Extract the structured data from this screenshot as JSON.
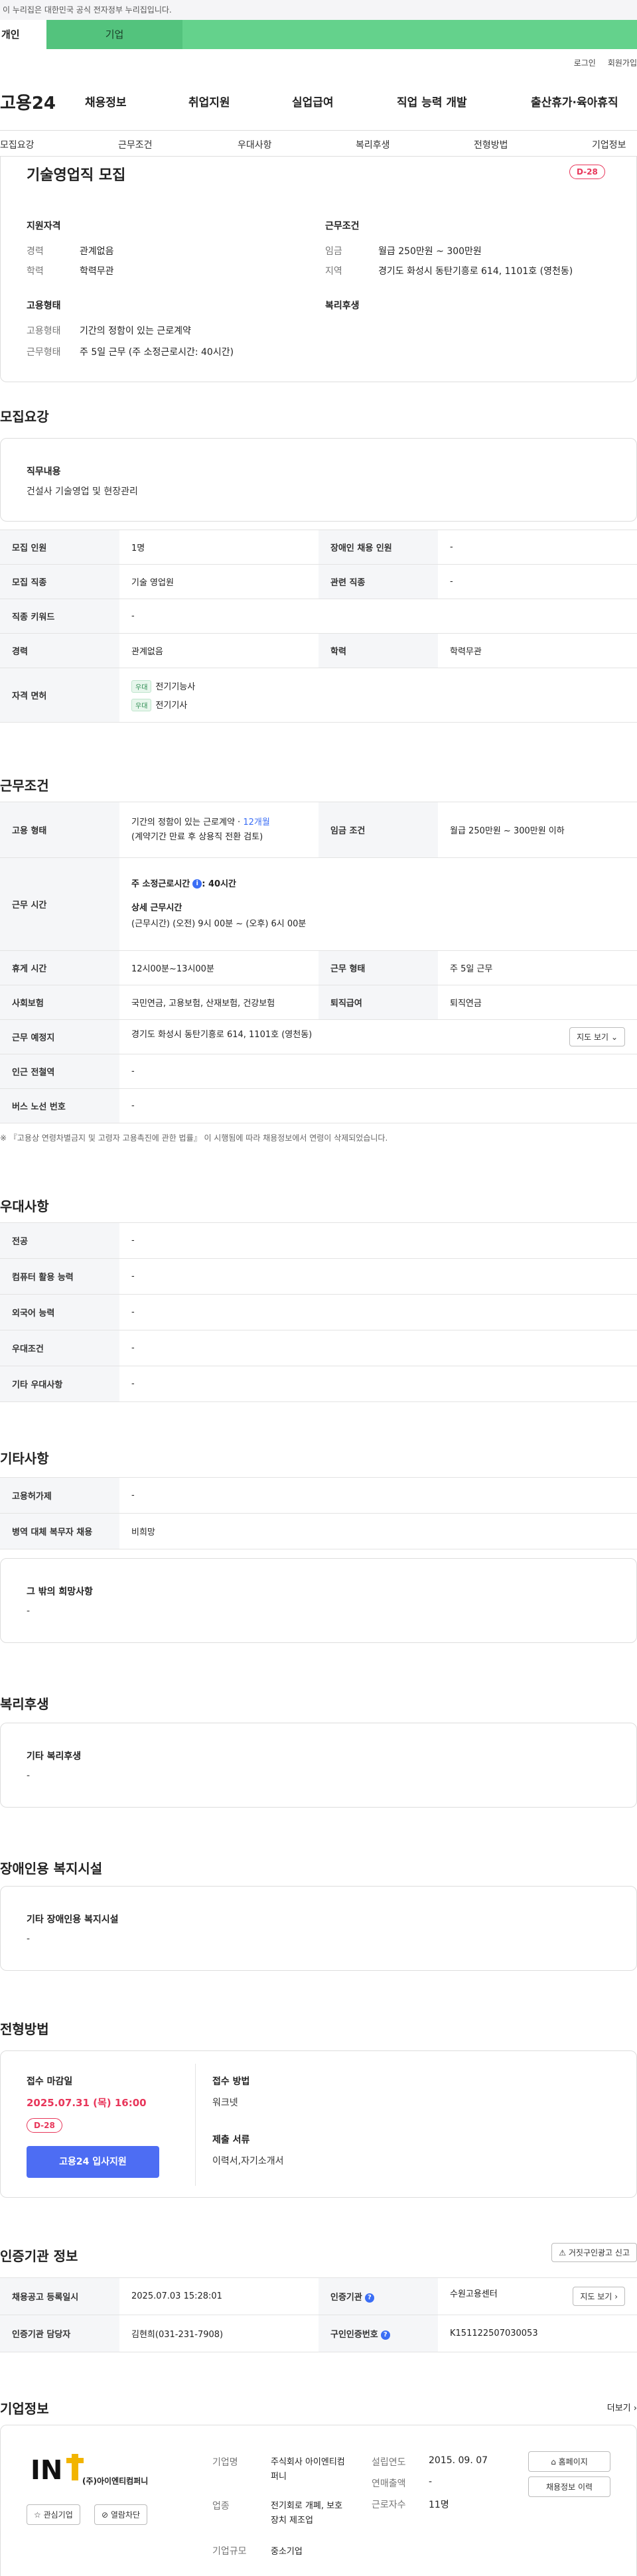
{
  "gov_banner": "이 누리집은 대한민국 공식 전자정부 누리집입니다.",
  "top_tabs": [
    "개인",
    "기업"
  ],
  "util_links": [
    "로그인",
    "회원가입"
  ],
  "logo": "고용24",
  "gnb": [
    "채용정보",
    "취업지원",
    "실업급여",
    "직업 능력 개발",
    "출산휴가·육아휴직"
  ],
  "subnav": [
    "모집요강",
    "근무조건",
    "우대사항",
    "복리후생",
    "전형방법",
    "기업정보"
  ],
  "job": {
    "title": "기술영업직 모집",
    "dday": "D-28",
    "summary": {
      "qual_h": "지원자격",
      "career_l": "경력",
      "career_v": "관계없음",
      "edu_l": "학력",
      "edu_v": "학력무관",
      "cond_h": "근무조건",
      "pay_l": "임금",
      "pay_v": "월급 250만원 ~ 300만원",
      "loc_l": "지역",
      "loc_v": "경기도 화성시 동탄기흥로 614, 1101호 (영천동)",
      "emp_h": "고용형태",
      "emp_type_l": "고용형태",
      "emp_type_v": "기간의 정함이 있는 근로계약",
      "work_form_l": "근무형태",
      "work_form_v": "주 5일 근무 (주 소정근로시간: 40시간)",
      "welfare_h": "복리후생"
    }
  },
  "recruit": {
    "heading": "모집요강",
    "duty_h": "직무내용",
    "duty_v": "건설사 기술영업 및 현장관리",
    "rows": {
      "headcount_l": "모집 인원",
      "headcount_v": "1명",
      "disabled_l": "장애인 채용 인원",
      "disabled_v": "-",
      "job_l": "모집 직종",
      "job_v": "기술 영업원",
      "related_l": "관련 직종",
      "related_v": "-",
      "kw_l": "직종 키워드",
      "kw_v": "-",
      "career_l": "경력",
      "career_v": "관계없음",
      "edu_l": "학력",
      "edu_v": "학력무관",
      "license_l": "자격 면허",
      "license_tag": "우대",
      "license_1": "전기기능사",
      "license_2": "전기기사"
    }
  },
  "work": {
    "heading": "근무조건",
    "emp_l": "고용 형태",
    "emp_v1": "기간의 정함이 있는 근로계약 · ",
    "emp_months": "12개월",
    "emp_v2": "(계약기간 만료 후 상용직 전환 검토)",
    "pay_l": "임금 조건",
    "pay_v": "월급 250만원 ~ 300만원 이하",
    "hours_l": "근무 시간",
    "hours_main": "주 소정근로시간",
    "hours_main_v": ": 40시간",
    "hours_detail_h": "상세 근무시간",
    "hours_detail_v": "(근무시간) (오전) 9시 00분 ~ (오후) 6시 00분",
    "rest_l": "휴게 시간",
    "rest_v": "12시00분~13시00분",
    "form_l": "근무 형태",
    "form_v": "주 5일 근무",
    "ins_l": "사회보험",
    "ins_v": "국민연금, 고용보험, 산재보험, 건강보험",
    "retire_l": "퇴직급여",
    "retire_v": "퇴직연금",
    "place_l": "근무 예정지",
    "place_v": "경기도 화성시 동탄기흥로 614, 1101호 (영천동)",
    "map_btn": "지도 보기",
    "station_l": "인근 전철역",
    "station_v": "-",
    "bus_l": "버스 노선 번호",
    "bus_v": "-",
    "note": "※ 『고용상 연령차별금지 및 고령자 고용촉진에 관한 법률』 이 시행됨에 따라 채용정보에서 연령이 삭제되었습니다."
  },
  "pref": {
    "heading": "우대사항",
    "rows": [
      {
        "l": "전공",
        "v": "-"
      },
      {
        "l": "컴퓨터 활용 능력",
        "v": "-"
      },
      {
        "l": "외국어 능력",
        "v": "-"
      },
      {
        "l": "우대조건",
        "v": "-"
      },
      {
        "l": "기타 우대사항",
        "v": "-"
      }
    ]
  },
  "etc": {
    "heading": "기타사항",
    "rows": [
      {
        "l": "고용허가제",
        "v": "-"
      },
      {
        "l": "병역 대체 복무자 채용",
        "v": "비희망"
      }
    ],
    "other_h": "그 밖의 희망사항",
    "other_v": "-"
  },
  "welfare": {
    "heading": "복리후생",
    "box_h": "기타 복리후생",
    "box_v": "-"
  },
  "disabled_fac": {
    "heading": "장애인용 복지시설",
    "box_h": "기타 장애인용 복지시설",
    "box_v": "-"
  },
  "process": {
    "heading": "전형방법",
    "deadline_h": "접수 마감일",
    "deadline_v": "2025.07.31 (목) 16:00",
    "dday": "D-28",
    "apply_btn": "고용24 입사지원",
    "method_h": "접수 방법",
    "method_v": "워크넷",
    "docs_h": "제출 서류",
    "docs_v": "이력서,자기소개서"
  },
  "agency": {
    "heading": "인증기관 정보",
    "report_btn": "거짓구인광고 신고",
    "reg_l": "채용공고 등록일시",
    "reg_v": "2025.07.03 15:28:01",
    "org_l": "인증기관",
    "org_v": "수원고용센터",
    "map_btn": "지도 보기",
    "mgr_l": "인증기관 담당자",
    "mgr_v": "김현희(031-231-7908)",
    "num_l": "구인인증번호",
    "num_v": "K151122507030053"
  },
  "company": {
    "heading": "기업정보",
    "more": "더보기",
    "logo_name": "(주)아이엔티컴퍼니",
    "fav_btn": "관심기업",
    "block_btn": "열람차단",
    "name_l": "기업명",
    "name_v": "주식회사 아이엔티컴퍼니",
    "ind_l": "업종",
    "ind_v": "전기회로 개폐, 보호장치 제조업",
    "size_l": "기업규모",
    "size_v": "중소기업",
    "est_l": "설립연도",
    "est_v": "2015. 09. 07",
    "sales_l": "연매출액",
    "sales_v": "-",
    "emp_l": "근로자수",
    "emp_v": "11명",
    "home_btn": "홈페이지",
    "hist_btn": "채용정보 이력"
  },
  "colors": {
    "accent_green": "#64d28c",
    "dday_red": "#e8365a",
    "apply_blue": "#4d6df3",
    "months_blue": "#3b6ef5"
  }
}
